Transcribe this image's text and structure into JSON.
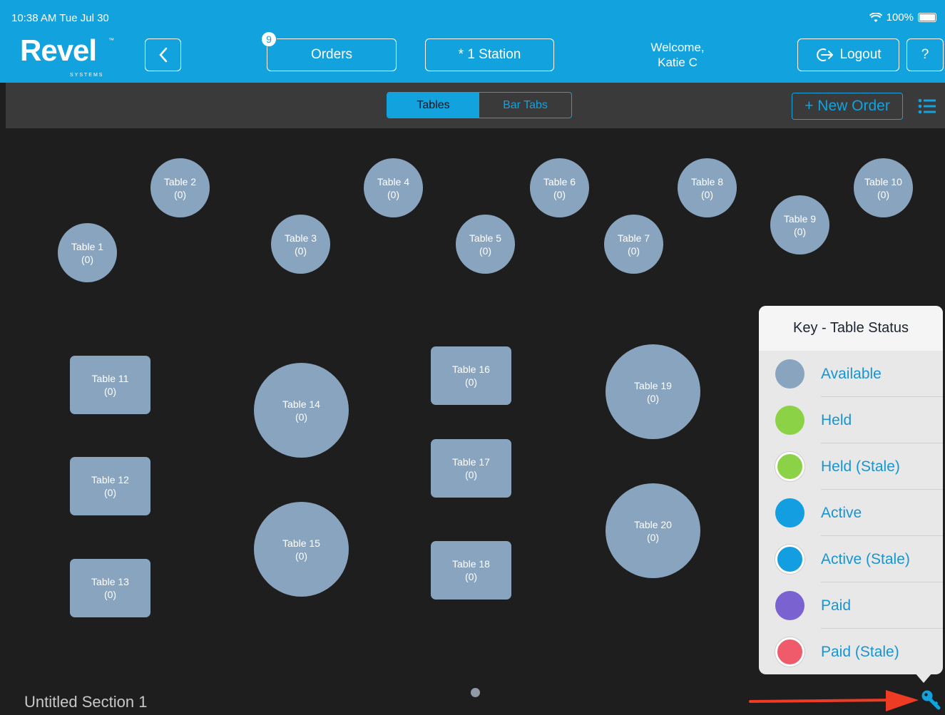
{
  "status_bar": {
    "time": "10:38 AM   Tue Jul 30",
    "battery": "100%"
  },
  "header": {
    "logo": "Revel",
    "logo_sub": "SYSTEMS",
    "logo_tm": "™",
    "back_label": "<",
    "orders_badge": "9",
    "orders_label": "Orders",
    "station_label": "* 1 Station",
    "welcome_line1": "Welcome,",
    "welcome_line2": "Katie C",
    "logout_label": "Logout",
    "help_label": "?"
  },
  "toolbar": {
    "tabs": [
      {
        "label": "Tables",
        "active": true
      },
      {
        "label": "Bar Tabs",
        "active": false
      }
    ],
    "new_order_label": "+ New Order"
  },
  "tables": [
    {
      "name": "Table 1",
      "count": "(0)"
    },
    {
      "name": "Table 2",
      "count": "(0)"
    },
    {
      "name": "Table 3",
      "count": "(0)"
    },
    {
      "name": "Table 4",
      "count": "(0)"
    },
    {
      "name": "Table 5",
      "count": "(0)"
    },
    {
      "name": "Table 6",
      "count": "(0)"
    },
    {
      "name": "Table 7",
      "count": "(0)"
    },
    {
      "name": "Table 8",
      "count": "(0)"
    },
    {
      "name": "Table 9",
      "count": "(0)"
    },
    {
      "name": "Table 10",
      "count": "(0)"
    },
    {
      "name": "Table 11",
      "count": "(0)"
    },
    {
      "name": "Table 12",
      "count": "(0)"
    },
    {
      "name": "Table 13",
      "count": "(0)"
    },
    {
      "name": "Table 14",
      "count": "(0)"
    },
    {
      "name": "Table 15",
      "count": "(0)"
    },
    {
      "name": "Table 16",
      "count": "(0)"
    },
    {
      "name": "Table 17",
      "count": "(0)"
    },
    {
      "name": "Table 18",
      "count": "(0)"
    },
    {
      "name": "Table 19",
      "count": "(0)"
    },
    {
      "name": "Table 20",
      "count": "(0)"
    }
  ],
  "key": {
    "title": "Key - Table Status",
    "items": [
      {
        "label": "Available",
        "color": "#88a4bf",
        "stale": false
      },
      {
        "label": "Held",
        "color": "#8cd246",
        "stale": false
      },
      {
        "label": "Held (Stale)",
        "color": "#8cd246",
        "stale": true
      },
      {
        "label": "Active",
        "color": "#129ee0",
        "stale": false
      },
      {
        "label": "Active (Stale)",
        "color": "#129ee0",
        "stale": true
      },
      {
        "label": "Paid",
        "color": "#7b62d1",
        "stale": false
      },
      {
        "label": "Paid (Stale)",
        "color": "#ef5b6b",
        "stale": true
      }
    ]
  },
  "footer": {
    "section_name": "Untitled Section 1"
  },
  "colors": {
    "brand": "#12a3de",
    "table": "#88a4bf",
    "arrow": "#ee3b24"
  }
}
